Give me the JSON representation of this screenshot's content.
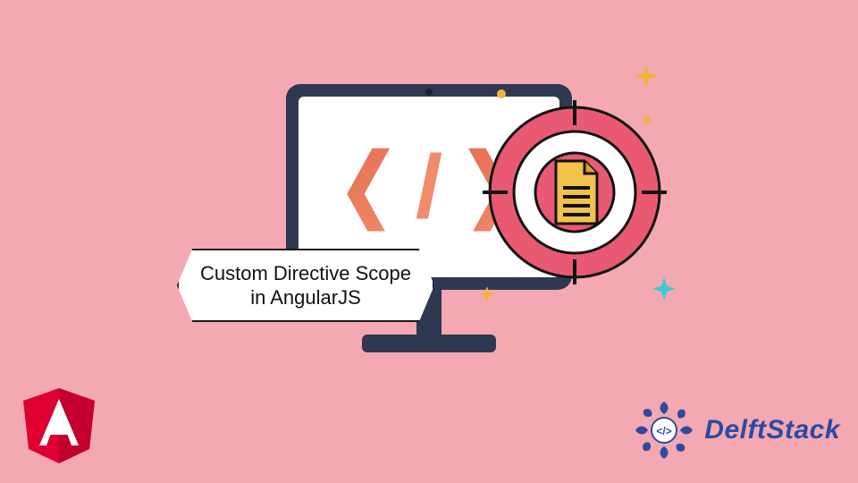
{
  "title_plate": {
    "line1": "Custom Directive Scope",
    "line2": "in AngularJS"
  },
  "monitor": {
    "code_symbol": "</>"
  },
  "brand": {
    "name": "DelftStack"
  },
  "logos": {
    "angular": "angular-logo",
    "delftstack": "delftstack-logo"
  },
  "target_badge": {
    "icon": "document-icon"
  },
  "colors": {
    "background": "#f3a8b2",
    "monitor_frame": "#2e3850",
    "accent_pink": "#e95a72",
    "accent_orange": "#e56b4e",
    "brand_blue": "#2d4aa3",
    "doc_yellow": "#f2c24a"
  }
}
